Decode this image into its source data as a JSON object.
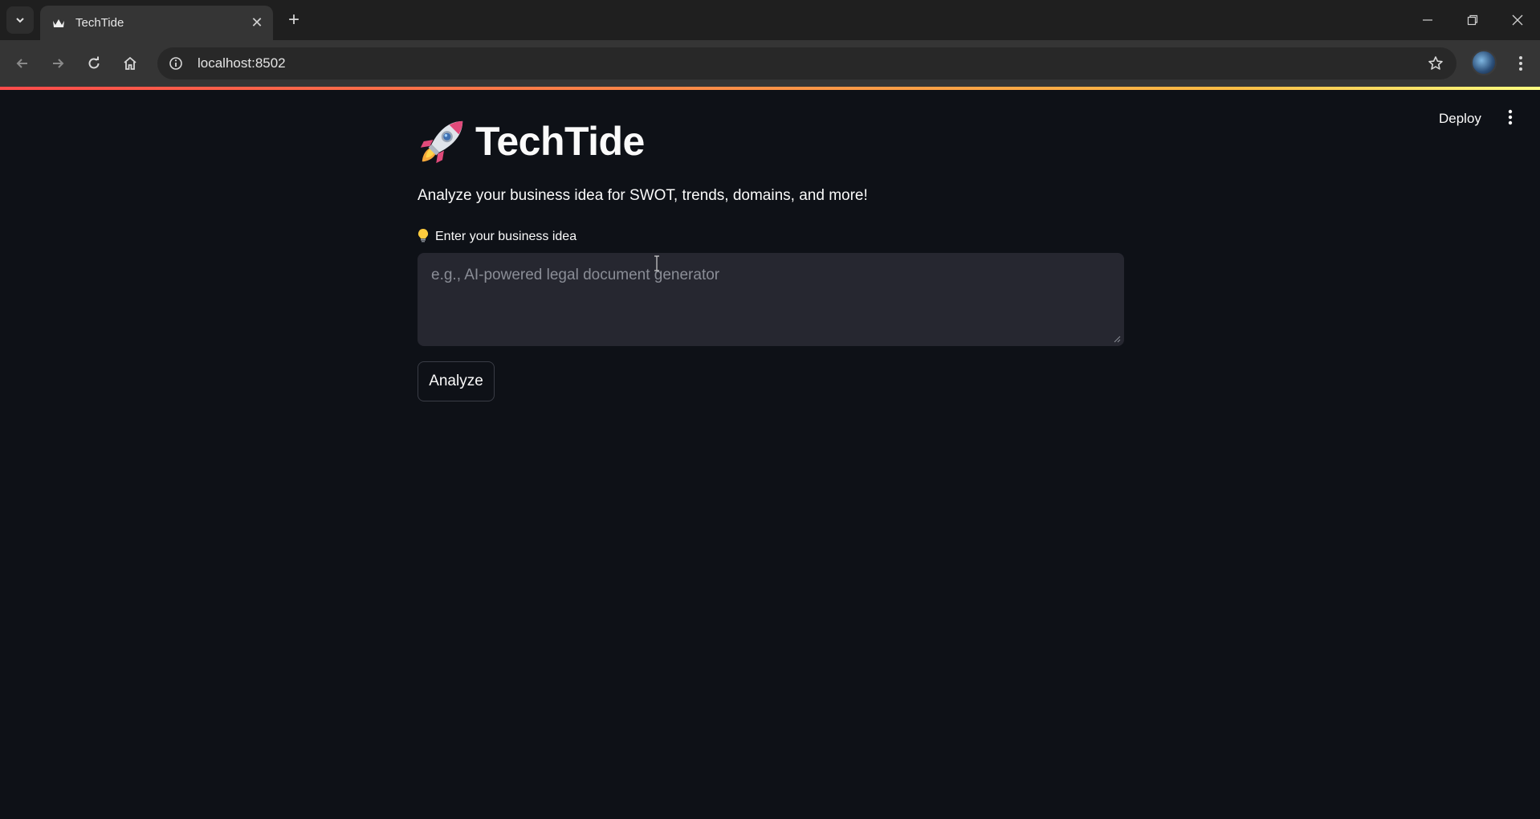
{
  "browser": {
    "tab_title": "TechTide",
    "url": "localhost:8502"
  },
  "header": {
    "deploy_label": "Deploy"
  },
  "main": {
    "title": "TechTide",
    "subtitle": "Analyze your business idea for SWOT, trends, domains, and more!",
    "idea_label": "Enter your business idea",
    "idea_placeholder": "e.g., AI-powered legal document generator",
    "idea_value": "",
    "analyze_label": "Analyze"
  },
  "icons": {
    "title_icon": "rocket-icon",
    "label_icon": "lightbulb-icon"
  },
  "colors": {
    "background": "#0e1117",
    "input_background": "#262730",
    "text": "#fafafa",
    "accent_start": "#ff4b4b",
    "accent_end": "#fffd80"
  }
}
